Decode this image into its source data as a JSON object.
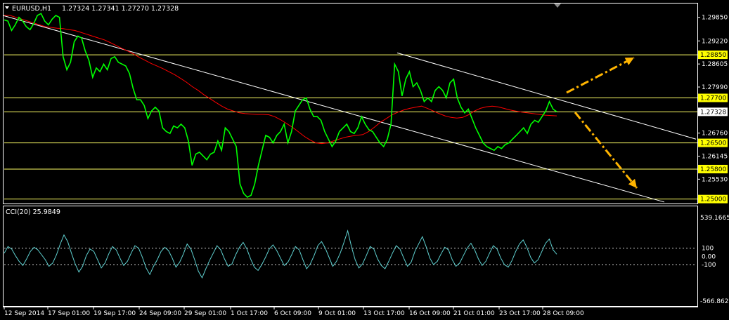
{
  "header": {
    "menu_icon": "triangle-down-icon",
    "symbol": "EURUSD,H1",
    "ohlc": "1.27324 1.27341 1.27270 1.27328"
  },
  "indicator": {
    "label": "CCI(20) 25.9849"
  },
  "colors": {
    "background": "#000000",
    "price": "#00ff00",
    "moving_average": "#ff0000",
    "trend_lines": "#ffffff",
    "level_label_bg": "#ffff00",
    "arrows": "#ffb400",
    "cci": "#5fd0d0"
  },
  "chart_data": [
    {
      "type": "line",
      "series": [
        {
          "name": "",
          "values": [
            1.2978,
            1.2975,
            1.295,
            1.2965,
            1.2985,
            1.2975,
            1.296,
            1.2952,
            1.2968,
            1.299,
            1.2995,
            1.2975,
            1.2965,
            1.298,
            1.299,
            1.2985,
            1.288,
            1.2845,
            1.2865,
            1.292,
            1.2935,
            1.293,
            1.2895,
            1.287,
            1.2825,
            1.285,
            1.284,
            1.286,
            1.2845,
            1.2875,
            1.288,
            1.2865,
            1.286,
            1.2855,
            1.2835,
            1.2795,
            1.2765,
            1.2765,
            1.275,
            1.2715,
            1.2735,
            1.2745,
            1.2735,
            1.269,
            1.268,
            1.2675,
            1.2695,
            1.269,
            1.27,
            1.269,
            1.2655,
            1.259,
            1.262,
            1.2625,
            1.2615,
            1.2605,
            1.262,
            1.2625,
            1.2655,
            1.263,
            1.269,
            1.268,
            1.266,
            1.264,
            1.254,
            1.2515,
            1.2505,
            1.251,
            1.254,
            1.259,
            1.263,
            1.267,
            1.2665,
            1.265,
            1.267,
            1.268,
            1.27,
            1.265,
            1.268,
            1.2735,
            1.275,
            1.2765,
            1.277,
            1.274,
            1.272,
            1.272,
            1.271,
            1.268,
            1.266,
            1.264,
            1.2655,
            1.268,
            1.269,
            1.27,
            1.268,
            1.2675,
            1.269,
            1.272,
            1.27,
            1.2685,
            1.268,
            1.2665,
            1.265,
            1.264,
            1.266,
            1.27,
            1.286,
            1.284,
            1.2775,
            1.282,
            1.284,
            1.28,
            1.281,
            1.279,
            1.276,
            1.277,
            1.276,
            1.279,
            1.28,
            1.279,
            1.277,
            1.281,
            1.282,
            1.277,
            1.2745,
            1.273,
            1.274,
            1.2715,
            1.269,
            1.267,
            1.265,
            1.264,
            1.2635,
            1.263,
            1.264,
            1.2635,
            1.2645,
            1.265,
            1.266,
            1.267,
            1.268,
            1.269,
            1.2675,
            1.27,
            1.271,
            1.2705,
            1.272,
            1.2735,
            1.276,
            1.274,
            1.2733
          ]
        },
        {
          "name": "",
          "values": [
            1.299,
            1.299,
            1.2985,
            1.298,
            1.2975,
            1.297,
            1.2965,
            1.296,
            1.2958,
            1.2956,
            1.2955,
            1.2952,
            1.295,
            1.2945,
            1.294,
            1.2935,
            1.293,
            1.2925,
            1.2918,
            1.291,
            1.2902,
            1.2895,
            1.2887,
            1.2878,
            1.287,
            1.2862,
            1.2855,
            1.2848,
            1.284,
            1.2832,
            1.2822,
            1.2812,
            1.28,
            1.279,
            1.2778,
            1.2768,
            1.2758,
            1.2748,
            1.274,
            1.2735,
            1.273,
            1.2728,
            1.2727,
            1.2726,
            1.2726,
            1.2725,
            1.272,
            1.2712,
            1.2702,
            1.2692,
            1.268,
            1.2668,
            1.2658,
            1.265,
            1.2648,
            1.265,
            1.2655,
            1.266,
            1.2665,
            1.2668,
            1.267,
            1.2672,
            1.268,
            1.2692,
            1.2705,
            1.2715,
            1.2725,
            1.2732,
            1.2738,
            1.2742,
            1.2745,
            1.2748,
            1.2742,
            1.2735,
            1.2728,
            1.2722,
            1.2718,
            1.2716,
            1.2718,
            1.2725,
            1.2735,
            1.2742,
            1.2746,
            1.2748,
            1.2746,
            1.2742,
            1.2738,
            1.2735,
            1.2732,
            1.273,
            1.2728,
            1.2726,
            1.2724,
            1.2723,
            1.2722
          ]
        }
      ],
      "x": [],
      "x_tick_labels": [
        "12 Sep 2014",
        "17 Sep 01:00",
        "19 Sep 17:00",
        "24 Sep 09:00",
        "29 Sep 01:00",
        "1 Oct 17:00",
        "6 Oct 09:00",
        "9 Oct 01:00",
        "13 Oct 17:00",
        "16 Oct 09:00",
        "21 Oct 01:00",
        "23 Oct 17:00",
        "28 Oct 09:00"
      ],
      "y_tick_labels": [
        "1.29850",
        "1.29220",
        "1.28850",
        "1.28605",
        "1.27990",
        "1.27700",
        "1.27328",
        "1.26760",
        "1.26500",
        "1.26145",
        "1.25800",
        "1.25530",
        "1.25000"
      ],
      "highlighted_levels": [
        "1.28850",
        "1.27700",
        "1.27328",
        "1.26500",
        "1.25800",
        "1.25000"
      ],
      "ylim": [
        1.249,
        1.302
      ]
    },
    {
      "type": "line",
      "series": [
        {
          "name": "",
          "values": [
            40,
            120,
            90,
            10,
            -60,
            -110,
            -30,
            60,
            110,
            80,
            20,
            -40,
            -120,
            -80,
            20,
            150,
            260,
            180,
            40,
            -90,
            -190,
            -120,
            10,
            90,
            60,
            -40,
            -140,
            -80,
            30,
            120,
            80,
            -20,
            -110,
            -60,
            40,
            130,
            100,
            -10,
            -140,
            -220,
            -120,
            -40,
            60,
            110,
            70,
            -20,
            -130,
            -70,
            30,
            150,
            90,
            -40,
            -180,
            -260,
            -150,
            -50,
            40,
            130,
            80,
            -30,
            -120,
            -90,
            20,
            110,
            170,
            90,
            -30,
            -130,
            -170,
            -100,
            -10,
            90,
            140,
            70,
            -20,
            -110,
            -70,
            20,
            120,
            80,
            -40,
            -150,
            -90,
            10,
            130,
            180,
            100,
            -10,
            -120,
            -60,
            40,
            170,
            310,
            120,
            -40,
            -140,
            -90,
            10,
            120,
            90,
            -30,
            -110,
            -150,
            -60,
            40,
            130,
            90,
            -20,
            -120,
            -70,
            60,
            150,
            240,
            120,
            -20,
            -100,
            -60,
            30,
            110,
            80,
            -40,
            -120,
            -80,
            10,
            100,
            160,
            80,
            -30,
            -110,
            -60,
            40,
            130,
            90,
            -20,
            -100,
            -130,
            -50,
            60,
            150,
            200,
            110,
            -10,
            -80,
            -40,
            60,
            160,
            210,
            80,
            26
          ]
        }
      ],
      "y_tick_labels": [
        "539.1665",
        "100",
        "0.00",
        "-100",
        "-566.8629"
      ],
      "ylim": [
        -566.8629,
        539.1665
      ]
    }
  ]
}
